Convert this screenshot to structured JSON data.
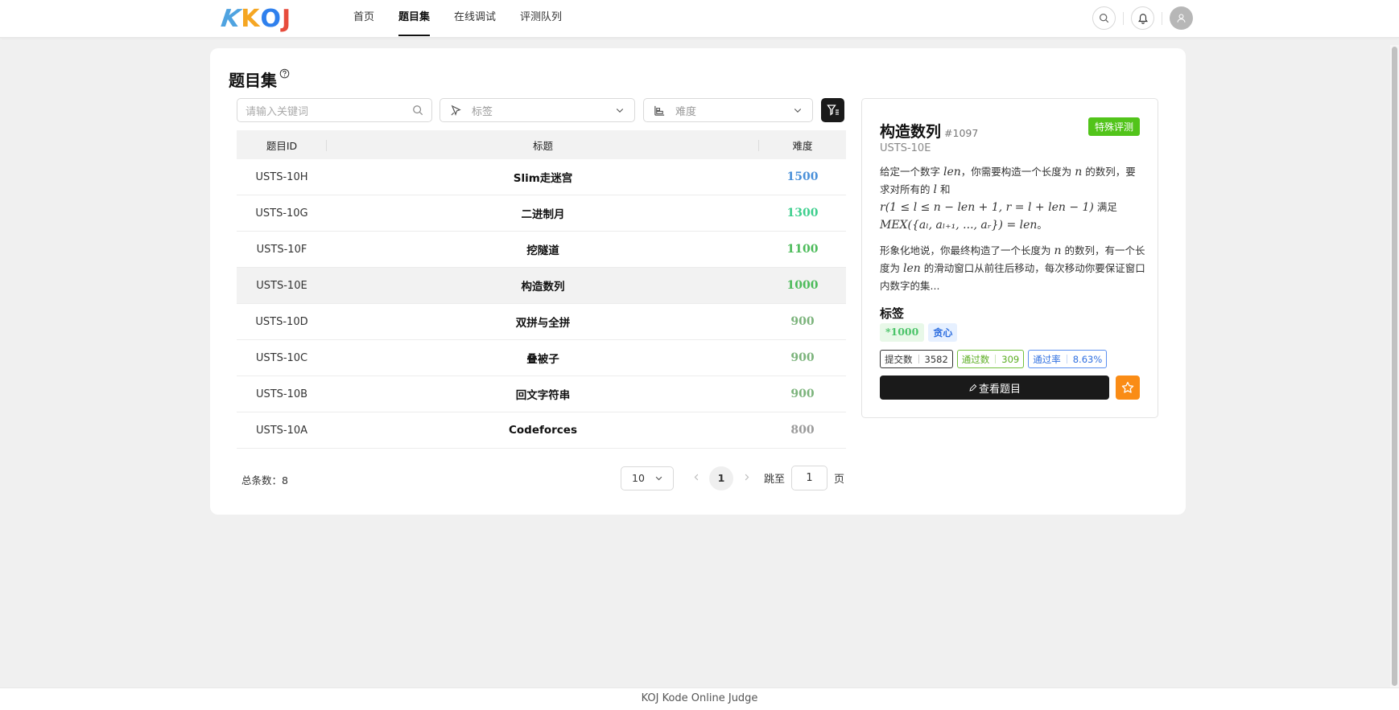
{
  "brand": {
    "logo": "KOJ"
  },
  "nav": [
    {
      "label": "首页",
      "active": false
    },
    {
      "label": "题目集",
      "active": true
    },
    {
      "label": "在线调试",
      "active": false
    },
    {
      "label": "评测队列",
      "active": false
    }
  ],
  "page": {
    "title": "题目集"
  },
  "filters": {
    "search_placeholder": "请输入关键词",
    "tag_placeholder": "标签",
    "difficulty_placeholder": "难度"
  },
  "table": {
    "headers": {
      "id": "题目ID",
      "title": "标题",
      "difficulty": "难度"
    },
    "rows": [
      {
        "id": "USTS-10H",
        "title": "Slim走迷宫",
        "difficulty": "1500",
        "color": "#4a90d9"
      },
      {
        "id": "USTS-10G",
        "title": "二进制月",
        "difficulty": "1300",
        "color": "#3ecf8e"
      },
      {
        "id": "USTS-10F",
        "title": "挖隧道",
        "difficulty": "1100",
        "color": "#4cbb5a"
      },
      {
        "id": "USTS-10E",
        "title": "构造数列",
        "difficulty": "1000",
        "color": "#4cbb5a"
      },
      {
        "id": "USTS-10D",
        "title": "双拼与全拼",
        "difficulty": "900",
        "color": "#7bb37b"
      },
      {
        "id": "USTS-10C",
        "title": "叠被子",
        "difficulty": "900",
        "color": "#7bb37b"
      },
      {
        "id": "USTS-10B",
        "title": "回文字符串",
        "difficulty": "900",
        "color": "#7bb37b"
      },
      {
        "id": "USTS-10A",
        "title": "Codeforces",
        "difficulty": "800",
        "color": "#9a9a9a"
      }
    ]
  },
  "pagination": {
    "total_label": "总条数：8",
    "page_size": "10",
    "current_page": "1",
    "jump_label": "跳至",
    "jump_value": "1",
    "page_suffix": "页"
  },
  "detail": {
    "title": "构造数列",
    "problem_number": "#1097",
    "badge": "特殊评测",
    "code": "USTS-10E",
    "desc_p1": {
      "t1": "给定一个数字 ",
      "m1": "len",
      "t2": "，你需要构造一个长度为 ",
      "m2": "n",
      "t3": " 的数列，要求对所有的 ",
      "m3": "l",
      "t4": " 和",
      "m4": "r(1 ≤ l ≤ n − len + 1, r = l + len − 1)",
      "t5": " 满足",
      "m5": "MEX({aₗ, aₗ₊₁, ..., aᵣ}) = len",
      "t6": "。"
    },
    "desc_p2": {
      "t1": "形象化地说，你最终构造了一个长度为 ",
      "m1": "n",
      "t2": " 的数列，有一个长度为 ",
      "m2": "len",
      "t3": " 的滑动窗口从前往后移动，每次移动你要保证窗口内数字的集..."
    },
    "tags_title": "标签",
    "tags": {
      "difficulty": "*1000",
      "category": "贪心"
    },
    "stats": {
      "submit_label": "提交数",
      "submit_value": "3582",
      "pass_label": "通过数",
      "pass_value": "309",
      "rate_label": "通过率",
      "rate_value": "8.63%"
    },
    "view_button": "查看题目"
  },
  "footer": {
    "text": "KOJ Kode Online Judge"
  }
}
